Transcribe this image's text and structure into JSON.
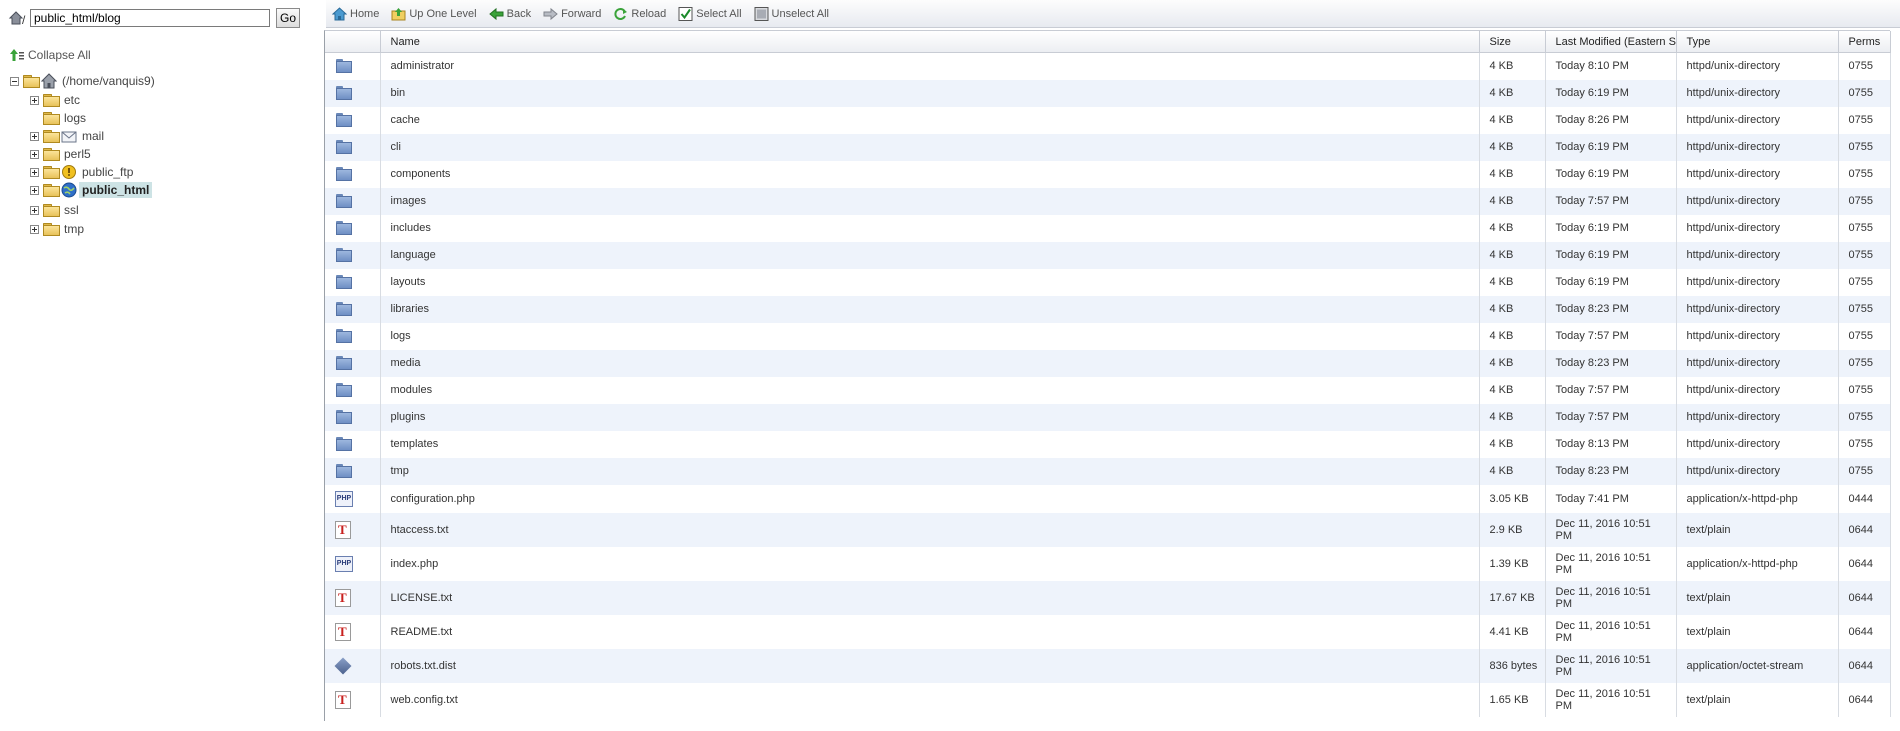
{
  "path_bar": {
    "value": "public_html/blog",
    "go_label": "Go"
  },
  "tree": {
    "collapse_all": "Collapse All",
    "root_label": "(/home/vanquis9)",
    "items": [
      {
        "label": "etc",
        "expandable": true,
        "badge": ""
      },
      {
        "label": "logs",
        "expandable": false,
        "badge": ""
      },
      {
        "label": "mail",
        "expandable": true,
        "badge": "mail-icon"
      },
      {
        "label": "perl5",
        "expandable": true,
        "badge": ""
      },
      {
        "label": "public_ftp",
        "expandable": true,
        "badge": "warning-icon"
      },
      {
        "label": "public_html",
        "expandable": true,
        "badge": "globe-icon",
        "selected": true
      },
      {
        "label": "ssl",
        "expandable": true,
        "badge": ""
      },
      {
        "label": "tmp",
        "expandable": true,
        "badge": ""
      }
    ]
  },
  "toolbar": {
    "home": "Home",
    "up_one_level": "Up One Level",
    "back": "Back",
    "forward": "Forward",
    "reload": "Reload",
    "select_all": "Select All",
    "unselect_all": "Unselect All"
  },
  "table": {
    "headers": {
      "name": "Name",
      "size": "Size",
      "modified": "Last Modified (Eastern S",
      "type": "Type",
      "perms": "Perms"
    },
    "rows": [
      {
        "icon": "folder-icon",
        "name": "administrator",
        "size": "4 KB",
        "modified": "Today 8:10 PM",
        "type": "httpd/unix-directory",
        "perms": "0755"
      },
      {
        "icon": "folder-icon",
        "name": "bin",
        "size": "4 KB",
        "modified": "Today 6:19 PM",
        "type": "httpd/unix-directory",
        "perms": "0755"
      },
      {
        "icon": "folder-icon",
        "name": "cache",
        "size": "4 KB",
        "modified": "Today 8:26 PM",
        "type": "httpd/unix-directory",
        "perms": "0755"
      },
      {
        "icon": "folder-icon",
        "name": "cli",
        "size": "4 KB",
        "modified": "Today 6:19 PM",
        "type": "httpd/unix-directory",
        "perms": "0755"
      },
      {
        "icon": "folder-icon",
        "name": "components",
        "size": "4 KB",
        "modified": "Today 6:19 PM",
        "type": "httpd/unix-directory",
        "perms": "0755"
      },
      {
        "icon": "folder-icon",
        "name": "images",
        "size": "4 KB",
        "modified": "Today 7:57 PM",
        "type": "httpd/unix-directory",
        "perms": "0755"
      },
      {
        "icon": "folder-icon",
        "name": "includes",
        "size": "4 KB",
        "modified": "Today 6:19 PM",
        "type": "httpd/unix-directory",
        "perms": "0755"
      },
      {
        "icon": "folder-icon",
        "name": "language",
        "size": "4 KB",
        "modified": "Today 6:19 PM",
        "type": "httpd/unix-directory",
        "perms": "0755"
      },
      {
        "icon": "folder-icon",
        "name": "layouts",
        "size": "4 KB",
        "modified": "Today 6:19 PM",
        "type": "httpd/unix-directory",
        "perms": "0755"
      },
      {
        "icon": "folder-icon",
        "name": "libraries",
        "size": "4 KB",
        "modified": "Today 8:23 PM",
        "type": "httpd/unix-directory",
        "perms": "0755"
      },
      {
        "icon": "folder-icon",
        "name": "logs",
        "size": "4 KB",
        "modified": "Today 7:57 PM",
        "type": "httpd/unix-directory",
        "perms": "0755"
      },
      {
        "icon": "folder-icon",
        "name": "media",
        "size": "4 KB",
        "modified": "Today 8:23 PM",
        "type": "httpd/unix-directory",
        "perms": "0755"
      },
      {
        "icon": "folder-icon",
        "name": "modules",
        "size": "4 KB",
        "modified": "Today 7:57 PM",
        "type": "httpd/unix-directory",
        "perms": "0755"
      },
      {
        "icon": "folder-icon",
        "name": "plugins",
        "size": "4 KB",
        "modified": "Today 7:57 PM",
        "type": "httpd/unix-directory",
        "perms": "0755"
      },
      {
        "icon": "folder-icon",
        "name": "templates",
        "size": "4 KB",
        "modified": "Today 8:13 PM",
        "type": "httpd/unix-directory",
        "perms": "0755"
      },
      {
        "icon": "folder-icon",
        "name": "tmp",
        "size": "4 KB",
        "modified": "Today 8:23 PM",
        "type": "httpd/unix-directory",
        "perms": "0755"
      },
      {
        "icon": "php-file-icon",
        "name": "configuration.php",
        "size": "3.05 KB",
        "modified": "Today 7:41 PM",
        "type": "application/x-httpd-php",
        "perms": "0444"
      },
      {
        "icon": "text-file-icon",
        "name": "htaccess.txt",
        "size": "2.9 KB",
        "modified": "Dec 11, 2016 10:51 PM",
        "type": "text/plain",
        "perms": "0644"
      },
      {
        "icon": "php-file-icon",
        "name": "index.php",
        "size": "1.39 KB",
        "modified": "Dec 11, 2016 10:51 PM",
        "type": "application/x-httpd-php",
        "perms": "0644"
      },
      {
        "icon": "text-file-icon",
        "name": "LICENSE.txt",
        "size": "17.67 KB",
        "modified": "Dec 11, 2016 10:51 PM",
        "type": "text/plain",
        "perms": "0644"
      },
      {
        "icon": "text-file-icon",
        "name": "README.txt",
        "size": "4.41 KB",
        "modified": "Dec 11, 2016 10:51 PM",
        "type": "text/plain",
        "perms": "0644"
      },
      {
        "icon": "binary-file-icon",
        "name": "robots.txt.dist",
        "size": "836 bytes",
        "modified": "Dec 11, 2016 10:51 PM",
        "type": "application/octet-stream",
        "perms": "0644"
      },
      {
        "icon": "text-file-icon",
        "name": "web.config.txt",
        "size": "1.65 KB",
        "modified": "Dec 11, 2016 10:51 PM",
        "type": "text/plain",
        "perms": "0644"
      }
    ]
  }
}
